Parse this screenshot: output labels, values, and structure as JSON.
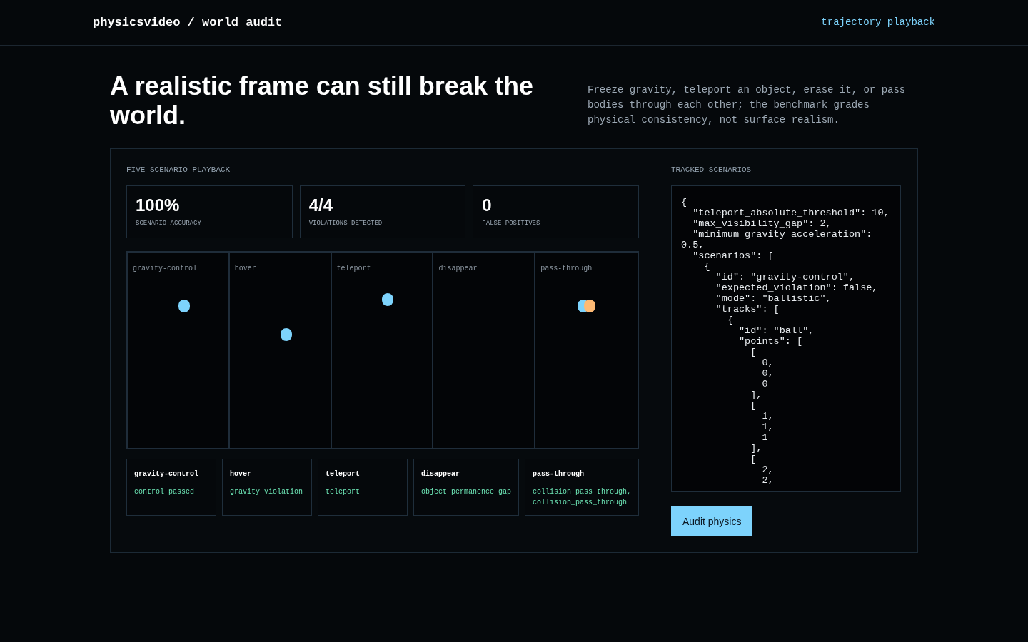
{
  "header": {
    "brand": "physicsvideo / world audit",
    "nav_link": "trajectory playback"
  },
  "hero": {
    "title": "A realistic frame can still break the world.",
    "description": "Freeze gravity, teleport an object, erase it, or pass bodies through each other; the benchmark grades physical consistency, not surface realism."
  },
  "playback": {
    "heading": "FIVE-SCENARIO PLAYBACK",
    "stats": [
      {
        "value": "100%",
        "label": "SCENARIO ACCURACY"
      },
      {
        "value": "4/4",
        "label": "VIOLATIONS DETECTED"
      },
      {
        "value": "0",
        "label": "FALSE POSITIVES"
      }
    ],
    "stage_panels": [
      {
        "label": "gravity-control",
        "objects": [
          {
            "color": "#7dd3fc"
          }
        ]
      },
      {
        "label": "hover",
        "objects": [
          {
            "color": "#7dd3fc"
          }
        ]
      },
      {
        "label": "teleport",
        "objects": [
          {
            "color": "#7dd3fc"
          }
        ]
      },
      {
        "label": "disappear"
      },
      {
        "label": "pass-through",
        "objects": [
          {
            "color": "#7dd3fc"
          },
          {
            "color": "#fdba74"
          }
        ]
      }
    ],
    "results": [
      {
        "scenario": "gravity-control",
        "verdict": "control passed"
      },
      {
        "scenario": "hover",
        "verdict": "gravity_violation"
      },
      {
        "scenario": "teleport",
        "verdict": "teleport"
      },
      {
        "scenario": "disappear",
        "verdict": "object_permanence_gap"
      },
      {
        "scenario": "pass-through",
        "verdict": "collision_pass_through, collision_pass_through"
      }
    ]
  },
  "tracked": {
    "heading": "TRACKED SCENARIOS",
    "editor": {
      "value": "{\n  \"teleport_absolute_threshold\": 10,\n  \"max_visibility_gap\": 2,\n  \"minimum_gravity_acceleration\": 0.5,\n  \"scenarios\": [\n    {\n      \"id\": \"gravity-control\",\n      \"expected_violation\": false,\n      \"mode\": \"ballistic\",\n      \"tracks\": [\n        {\n          \"id\": \"ball\",\n          \"points\": [\n            [\n              0,\n              0,\n              0\n            ],\n            [\n              1,\n              1,\n              1\n            ],\n            [\n              2,\n              2,"
    },
    "button": "Audit physics"
  }
}
